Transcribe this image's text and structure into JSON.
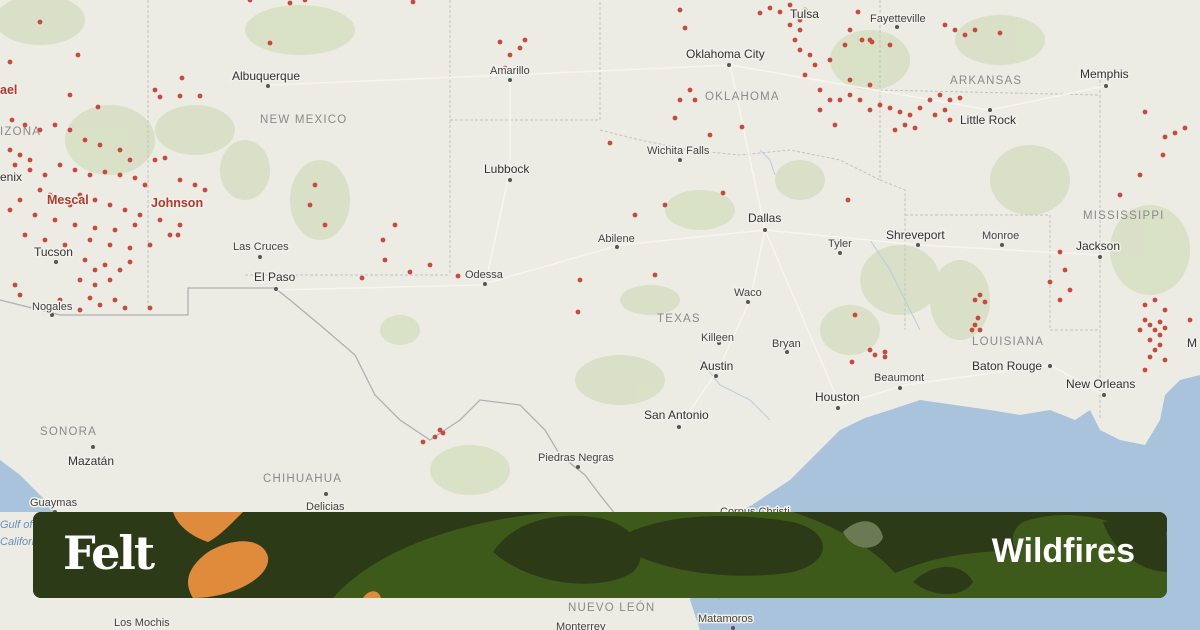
{
  "map": {
    "cities": [
      {
        "name": "Tulsa"
      },
      {
        "name": "Fayetteville"
      },
      {
        "name": "Oklahoma City"
      },
      {
        "name": "Amarillo"
      },
      {
        "name": "Albuquerque"
      },
      {
        "name": "Memphis"
      },
      {
        "name": "Little Rock"
      },
      {
        "name": "Lubbock"
      },
      {
        "name": "Wichita Falls"
      },
      {
        "name": "Dallas"
      },
      {
        "name": "Abilene"
      },
      {
        "name": "Tyler"
      },
      {
        "name": "Shreveport"
      },
      {
        "name": "Monroe"
      },
      {
        "name": "Jackson"
      },
      {
        "name": "Las Cruces"
      },
      {
        "name": "El Paso"
      },
      {
        "name": "Odessa"
      },
      {
        "name": "Waco"
      },
      {
        "name": "Killeen"
      },
      {
        "name": "Bryan"
      },
      {
        "name": "Austin"
      },
      {
        "name": "Beaumont"
      },
      {
        "name": "Baton Rouge"
      },
      {
        "name": "Houston"
      },
      {
        "name": "New Orleans"
      },
      {
        "name": "San Antonio"
      },
      {
        "name": "Piedras Negras"
      },
      {
        "name": "Tucson"
      },
      {
        "name": "Nogales"
      },
      {
        "name": "Mazatán"
      },
      {
        "name": "Guaymas"
      },
      {
        "name": "Delicias"
      },
      {
        "name": "Los Mochis"
      },
      {
        "name": "Matamoros"
      },
      {
        "name": "Monterrey"
      },
      {
        "name": "Corpus Christi"
      }
    ],
    "regions": [
      {
        "name": "NEW MEXICO"
      },
      {
        "name": "OKLAHOMA"
      },
      {
        "name": "ARKANSAS"
      },
      {
        "name": "TEXAS"
      },
      {
        "name": "MISSISSIPPI"
      },
      {
        "name": "LOUISIANA"
      },
      {
        "name": "SONORA"
      },
      {
        "name": "CHIHUAHUA"
      },
      {
        "name": "NUEVO LEÓN"
      },
      {
        "name": "IZONA"
      }
    ],
    "fire_labels": [
      {
        "name": "Mescal"
      },
      {
        "name": "Johnson"
      }
    ],
    "edge_labels": [
      {
        "name": "ael"
      },
      {
        "name": "enix"
      },
      {
        "name": "M"
      }
    ],
    "water_labels": [
      {
        "name": "Gulf of"
      },
      {
        "name": "California"
      }
    ],
    "colors": {
      "fire_point": "#c94a3c",
      "land": "#ecebe4",
      "water": "#a9c3dd",
      "park": "#cfd9b8",
      "border": "#b8b8b8"
    }
  },
  "banner": {
    "brand": "Felt",
    "title": "Wildfires",
    "colors": {
      "base": "#2c3a17",
      "mid": "#3e5a1a",
      "light": "#6b7a52",
      "accent": "#e08a3c"
    }
  }
}
